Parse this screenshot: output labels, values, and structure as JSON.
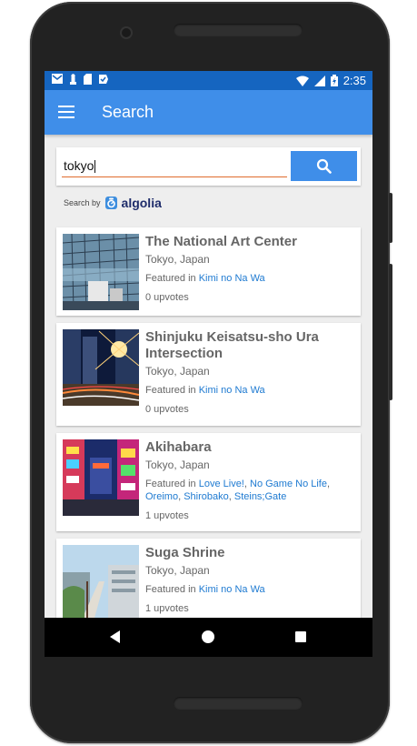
{
  "status_bar": {
    "time": "2:35"
  },
  "app_bar": {
    "title": "Search"
  },
  "search": {
    "query": "tokyo"
  },
  "powered_by": {
    "label": "Search by",
    "brand": "algolia"
  },
  "results": [
    {
      "title": "The National Art Center",
      "location": "Tokyo, Japan",
      "featured_label": "Featured in",
      "featured": [
        "Kimi no Na Wa"
      ],
      "upvotes": "0 upvotes"
    },
    {
      "title": "Shinjuku Keisatsu-sho Ura Intersection",
      "location": "Tokyo, Japan",
      "featured_label": "Featured in",
      "featured": [
        "Kimi no Na Wa"
      ],
      "upvotes": "0 upvotes"
    },
    {
      "title": "Akihabara",
      "location": "Tokyo, Japan",
      "featured_label": "Featured in",
      "featured": [
        "Love Live!",
        "No Game No Life",
        "Oreimo",
        "Shirobako",
        "Steins;Gate"
      ],
      "upvotes": "1 upvotes"
    },
    {
      "title": "Suga Shrine",
      "location": "Tokyo, Japan",
      "featured_label": "Featured in",
      "featured": [
        "Kimi no Na Wa"
      ],
      "upvotes": "1 upvotes"
    }
  ],
  "colors": {
    "primary": "#3f8ee9",
    "status": "#1565c0",
    "link": "#1e7ad1",
    "accent": "#e06c2d"
  }
}
